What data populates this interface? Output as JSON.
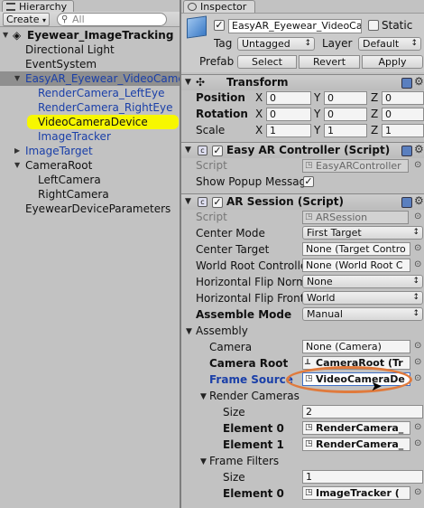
{
  "hierarchy": {
    "tab": "Hierarchy",
    "create_label": "Create",
    "search_placeholder": "All",
    "scene": "Eyewear_ImageTracking",
    "items": [
      {
        "label": "Directional Light"
      },
      {
        "label": "EventSystem"
      },
      {
        "label": "EasyAR_Eyewear_VideoCamera"
      },
      {
        "label": "RenderCamera_LeftEye"
      },
      {
        "label": "RenderCamera_RightEye"
      },
      {
        "label": "VideoCameraDevice"
      },
      {
        "label": "ImageTracker"
      },
      {
        "label": "ImageTarget"
      },
      {
        "label": "CameraRoot"
      },
      {
        "label": "LeftCamera"
      },
      {
        "label": "RightCamera"
      },
      {
        "label": "EyewearDeviceParameters"
      }
    ]
  },
  "inspector": {
    "tab": "Inspector",
    "object_name": "EasyAR_Eyewear_VideoCamera",
    "static_label": "Static",
    "tag_label": "Tag",
    "tag_value": "Untagged",
    "layer_label": "Layer",
    "layer_value": "Default",
    "prefab_label": "Prefab",
    "prefab_select": "Select",
    "prefab_revert": "Revert",
    "prefab_apply": "Apply",
    "transform": {
      "title": "Transform",
      "position_label": "Position",
      "rotation_label": "Rotation",
      "scale_label": "Scale",
      "axis_x": "X",
      "axis_y": "Y",
      "axis_z": "Z",
      "position": [
        "0",
        "0",
        "0"
      ],
      "rotation": [
        "0",
        "0",
        "0"
      ],
      "scale": [
        "1",
        "1",
        "1"
      ]
    },
    "controller": {
      "title": "Easy AR Controller (Script)",
      "script_label": "Script",
      "script_value": "EasyARController",
      "popup_label": "Show Popup Messag"
    },
    "session": {
      "title": "AR Session (Script)",
      "script_label": "Script",
      "script_value": "ARSession",
      "center_mode_label": "Center Mode",
      "center_mode_value": "First Target",
      "center_target_label": "Center Target",
      "center_target_value": "None (Target Contro",
      "world_root_label": "World Root Controlle",
      "world_root_value": "None (World Root C",
      "hflip_normal_label": "Horizontal Flip Norma",
      "hflip_normal_value": "None",
      "hflip_front_label": "Horizontal Flip Front",
      "hflip_front_value": "World",
      "assemble_mode_label": "Assemble Mode",
      "assemble_mode_value": "Manual",
      "assembly_label": "Assembly",
      "camera_label": "Camera",
      "camera_value": "None (Camera)",
      "camera_root_label": "Camera Root",
      "camera_root_value": "CameraRoot (Tr",
      "frame_source_label": "Frame Source",
      "frame_source_value": "VideoCameraDe",
      "render_cameras_label": "Render Cameras",
      "size_label": "Size",
      "render_size": "2",
      "element0_label": "Element 0",
      "element1_label": "Element 1",
      "render_e0": "RenderCamera_",
      "render_e1": "RenderCamera_",
      "frame_filters_label": "Frame Filters",
      "filters_size": "1",
      "filters_e0": "ImageTracker ("
    },
    "colors": {
      "highlight_circle": "#e07a3c",
      "selection_yellow": "#f7f700",
      "prefab_blue": "#1a3fa8"
    }
  }
}
